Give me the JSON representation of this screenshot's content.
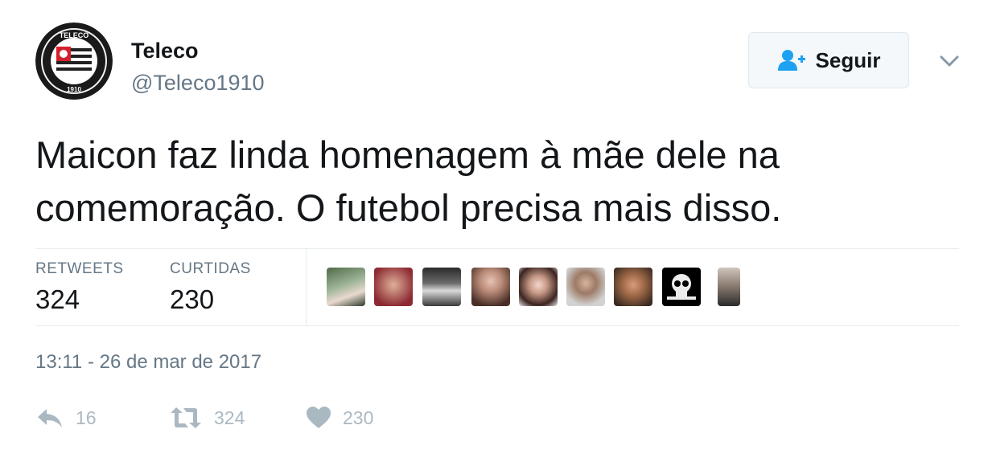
{
  "user": {
    "display_name": "Teleco",
    "handle": "@Teleco1910",
    "avatar_text_top": "TELECO",
    "avatar_text_bottom": "1910"
  },
  "follow_button": {
    "label": "Seguir",
    "icon": "follow-user-icon"
  },
  "menu": {
    "icon": "chevron-down-icon"
  },
  "tweet_text": "Maicon faz linda homenagem à mãe dele na comemoração. O futebol precisa mais disso.",
  "stats": {
    "retweets_label": "RETWEETS",
    "retweets_value": "324",
    "likes_label": "CURTIDAS",
    "likes_value": "230"
  },
  "likers_count_shown": 9,
  "timestamp": "13:11 - 26 de mar de 2017",
  "actions": {
    "reply_count": "16",
    "retweet_count": "324",
    "like_count": "230"
  },
  "colors": {
    "text": "#14171a",
    "secondary": "#657786",
    "action": "#aab8c2",
    "follow_icon": "#1da1f2",
    "border": "#e6ecf0"
  }
}
